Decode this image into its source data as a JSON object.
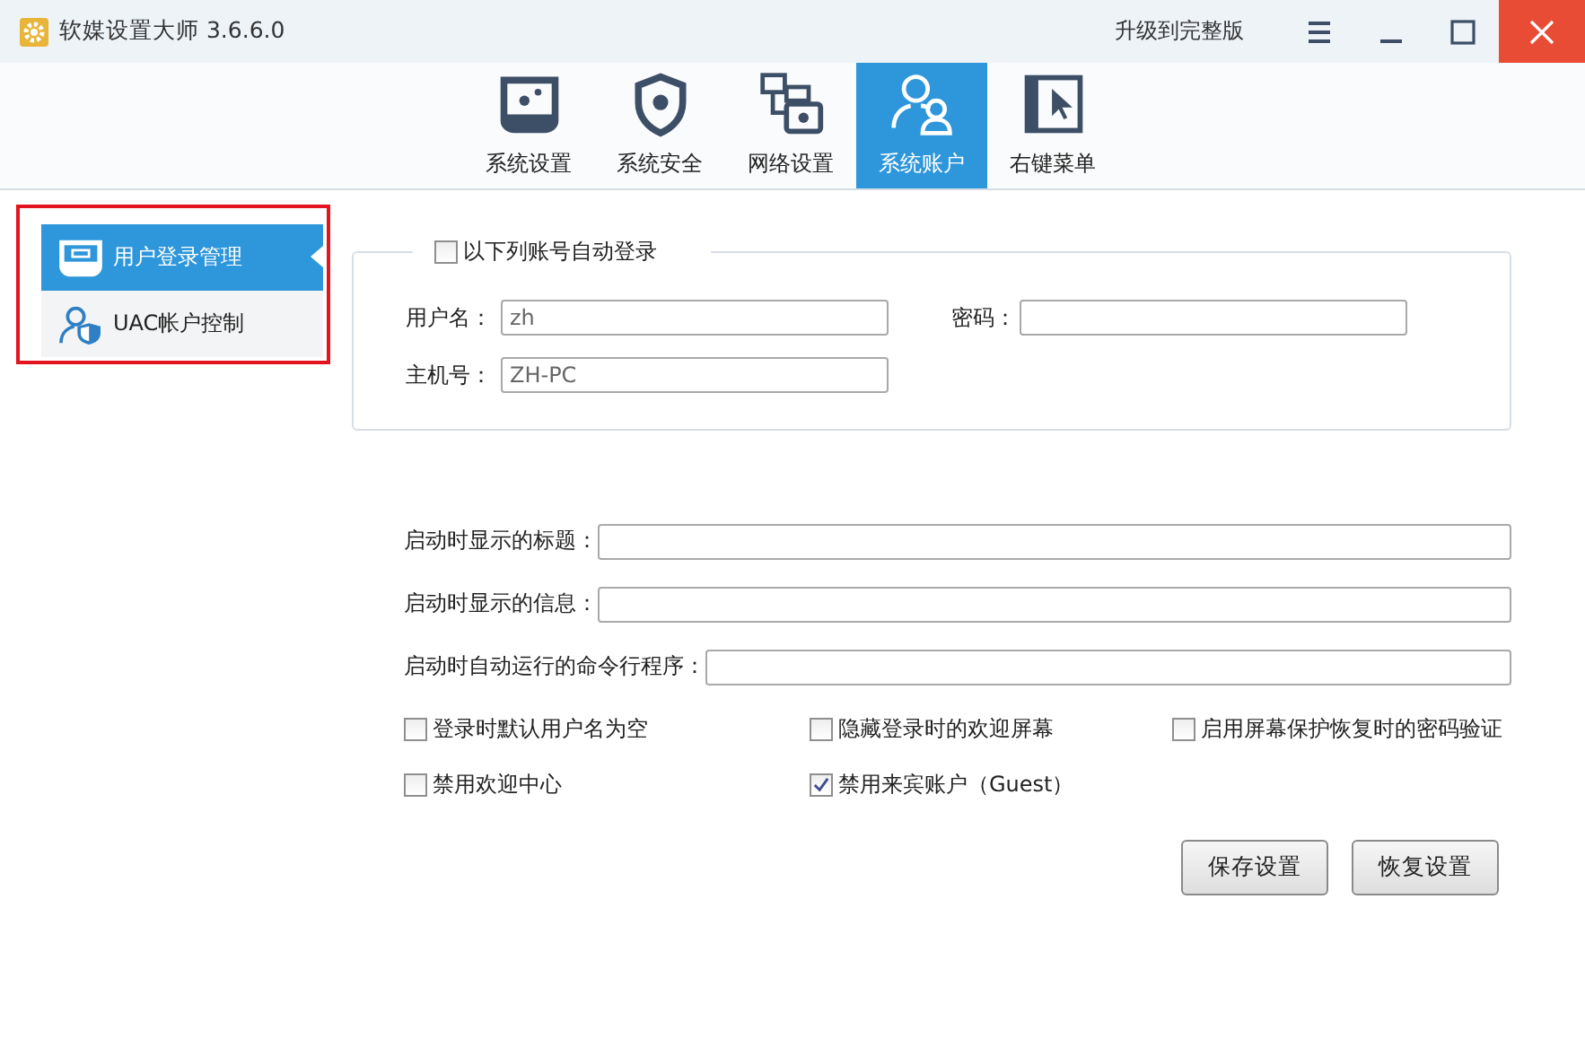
{
  "window": {
    "title": "软媒设置大师 3.6.6.0",
    "upgrade_link": "升级到完整版"
  },
  "tabs": [
    {
      "label": "系统设置",
      "selected": false,
      "kind": "monitor"
    },
    {
      "label": "系统安全",
      "selected": false,
      "kind": "shield"
    },
    {
      "label": "网络设置",
      "selected": false,
      "kind": "network"
    },
    {
      "label": "系统账户",
      "selected": true,
      "kind": "users"
    },
    {
      "label": "右键菜单",
      "selected": false,
      "kind": "cursor"
    }
  ],
  "sidebar": {
    "items": [
      {
        "label": "用户登录管理",
        "selected": true,
        "kind": "login"
      },
      {
        "label": "UAC帐户控制",
        "selected": false,
        "kind": "uac"
      }
    ]
  },
  "auto_login": {
    "label": "以下列账号自动登录",
    "checked": false,
    "fields": [
      {
        "label": "用户名：",
        "value": "zh"
      },
      {
        "label": "密码："
      },
      {
        "label": "主机号：",
        "value": "ZH-PC"
      }
    ]
  },
  "startup_fields": [
    {
      "label": "启动时显示的标题："
    },
    {
      "label": "启动时显示的信息："
    },
    {
      "label": "启动时自动运行的命令行程序："
    }
  ],
  "options": [
    {
      "label": "登录时默认用户名为空",
      "checked": false
    },
    {
      "label": "隐藏登录时的欢迎屏幕",
      "checked": false
    },
    {
      "label": "启用屏幕保护恢复时的密码验证",
      "checked": false
    },
    {
      "label": "禁用欢迎中心",
      "checked": false
    },
    {
      "label": "禁用来宾账户（Guest）",
      "checked": true
    }
  ],
  "buttons": [
    "保存设置",
    "恢复设置"
  ]
}
